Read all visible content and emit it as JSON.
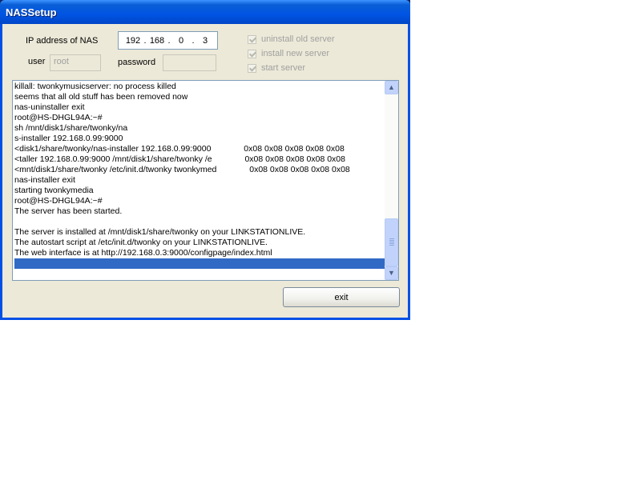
{
  "window": {
    "title": "NASSetup"
  },
  "form": {
    "ip_label": "IP address of NAS",
    "ip_octets": [
      "192",
      "168",
      "0",
      "3"
    ],
    "user_label": "user",
    "user_value": "root",
    "password_label": "password",
    "password_value": ""
  },
  "options": [
    {
      "label": "uninstall old server",
      "checked": true,
      "enabled": false
    },
    {
      "label": "install new server",
      "checked": true,
      "enabled": false
    },
    {
      "label": "start server",
      "checked": true,
      "enabled": false
    }
  ],
  "log": {
    "lines": [
      "killall: twonkymusicserver: no process killed",
      "seems that all old stuff has been removed now",
      "nas-uninstaller exit",
      "root@HS-DHGL94A:~#",
      "sh /mnt/disk1/share/twonky/na",
      "s-installer 192.168.0.99:9000",
      "<disk1/share/twonky/nas-installer 192.168.0.99:9000              0x08 0x08 0x08 0x08 0x08",
      "<taller 192.168.0.99:9000 /mnt/disk1/share/twonky /e              0x08 0x08 0x08 0x08 0x08",
      "<mnt/disk1/share/twonky /etc/init.d/twonky twonkymed              0x08 0x08 0x08 0x08 0x08",
      "nas-installer exit",
      "starting twonkymedia",
      "root@HS-DHGL94A:~#",
      "The server has been started.",
      "",
      "The server is installed at /mnt/disk1/share/twonky on your LINKSTATIONLIVE.",
      "The autostart script at /etc/init.d/twonky on your LINKSTATIONLIVE.",
      "The web interface is at http://192.168.0.3:9000/configpage/index.html",
      ""
    ],
    "selected_line_index": 17
  },
  "buttons": {
    "exit_label": "exit"
  },
  "scrollbar": {
    "position_fraction": 0.85
  }
}
